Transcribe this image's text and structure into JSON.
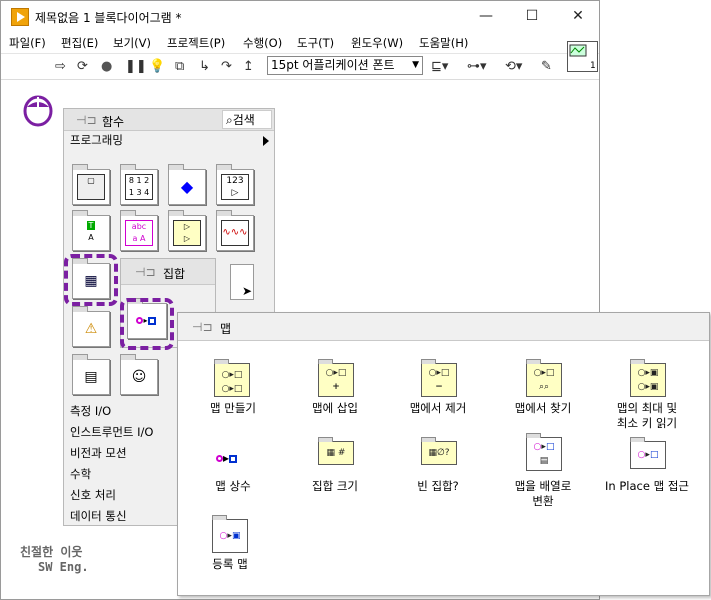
{
  "window": {
    "title": "제목없음 1 블록다이어그램 *",
    "controls": [
      "—",
      "☐",
      "✕"
    ]
  },
  "menus": [
    "파일(F)",
    "편집(E)",
    "보기(V)",
    "프로젝트(P)",
    "수행(O)",
    "도구(T)",
    "윈도우(W)",
    "도움말(H)"
  ],
  "toolbar": {
    "run": "⇨",
    "run_continuous": "⟳",
    "abort": "●",
    "pause": "❚❚",
    "highlight": "💡",
    "font_selector": "15pt 어플리케이션 폰트"
  },
  "functions_palette": {
    "title": "함수",
    "search_label": "검색",
    "programming_label": "프로그래밍",
    "categories": [
      "측정 I/O",
      "인스트루먼트 I/O",
      "비전과 모션",
      "수학",
      "신호 처리",
      "데이터 통신"
    ]
  },
  "set_palette": {
    "title": "집합"
  },
  "map_palette": {
    "title": "맵",
    "items": [
      {
        "label": "맵 만들기",
        "icon": "build-map-icon",
        "glyph": "○▸□"
      },
      {
        "label": "맵에 삽입",
        "icon": "insert-into-map-icon",
        "glyph": "+"
      },
      {
        "label": "맵에서 제거",
        "icon": "remove-from-map-icon",
        "glyph": "−"
      },
      {
        "label": "맵에서 찾기",
        "icon": "look-in-map-icon",
        "glyph": "⌕"
      },
      {
        "label": "맵의 최대 및\n최소 키 읽기",
        "icon": "map-max-min-keys-icon",
        "glyph": "⇕"
      },
      {
        "label": "맵 상수",
        "icon": "map-constant-icon",
        "glyph": ""
      },
      {
        "label": "집합 크기",
        "icon": "collection-size-icon",
        "glyph": "#"
      },
      {
        "label": "빈 집합?",
        "icon": "empty-collection-icon",
        "glyph": "∅?"
      },
      {
        "label": "맵을 배열로\n변환",
        "icon": "map-to-array-icon",
        "glyph": "▤"
      },
      {
        "label": "In Place 맵 접근",
        "icon": "in-place-map-access-icon",
        "glyph": "▭"
      },
      {
        "label": "등록 맵",
        "icon": "registration-map-icon",
        "glyph": "○▸▣"
      }
    ]
  },
  "watermark": {
    "line1": "친절한 이웃",
    "line2": "SW Eng."
  },
  "colors": {
    "highlight": "#7b1fa2",
    "tile_yellow": "#ffffc4"
  }
}
